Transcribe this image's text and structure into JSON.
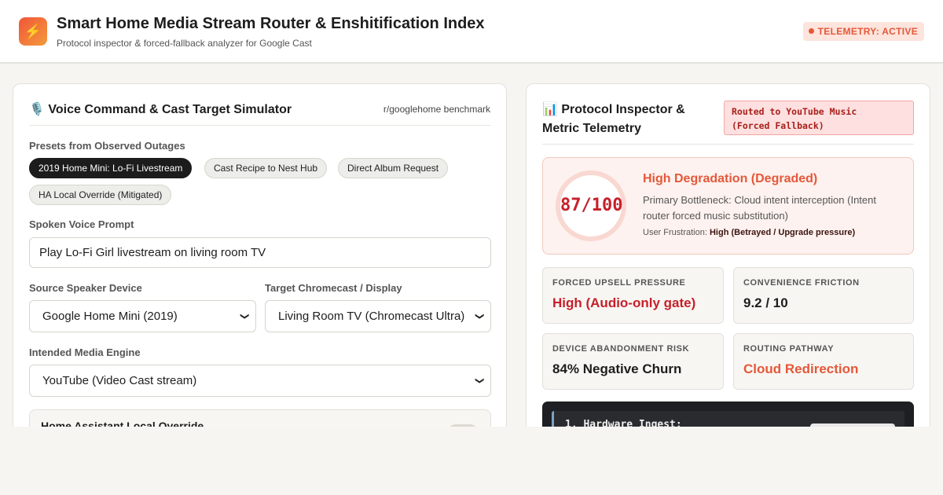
{
  "header": {
    "logo_icon": "lightning-bolt-icon",
    "logo_glyph": "⚡",
    "title": "Smart Home Media Stream Router & Enshitification Index",
    "subtitle": "Protocol inspector & forced-fallback analyzer for Google Cast",
    "status": "TELEMETRY: ACTIVE"
  },
  "simulator": {
    "icon": "microphone-icon",
    "icon_glyph": "🎙️",
    "title": "Voice Command & Cast Target Simulator",
    "meta": "r/googlehome benchmark",
    "presets_label": "Presets from Observed Outages",
    "presets": [
      {
        "label": "2019 Home Mini: Lo-Fi Livestream",
        "active": true
      },
      {
        "label": "Cast Recipe to Nest Hub",
        "active": false
      },
      {
        "label": "Direct Album Request",
        "active": false
      },
      {
        "label": "HA Local Override (Mitigated)",
        "active": false
      }
    ],
    "prompt_label": "Spoken Voice Prompt",
    "prompt_value": "Play Lo-Fi Girl livestream on living room TV",
    "source_label": "Source Speaker Device",
    "source_value": "Google Home Mini (2019)",
    "target_label": "Target Chromecast / Display",
    "target_value": "Living Room TV (Chromecast Ultra)",
    "engine_label": "Intended Media Engine",
    "engine_value": "YouTube (Video Cast stream)",
    "override_title": "Home Assistant Local Override",
    "override_enabled": false
  },
  "inspector": {
    "icon": "bar-chart-icon",
    "icon_glyph": "📊",
    "title_line1": "Protocol Inspector &",
    "title_line2": "Metric Telemetry",
    "route_line1": "Routed to YouTube Music",
    "route_line2": "(Forced Fallback)",
    "score": "87/100",
    "severity": "High Degradation (Degraded)",
    "bottleneck": "Primary Bottleneck: Cloud intent interception (Intent router forced music substitution)",
    "frustration_label": "User Frustration: ",
    "frustration_value": "High (Betrayed / Upgrade pressure)",
    "metrics": [
      {
        "label": "FORCED UPSELL PRESSURE",
        "value": "High (Audio-only gate)",
        "color": "#c6202a"
      },
      {
        "label": "CONVENIENCE FRICTION",
        "value": "9.2 / 10",
        "color": "#1d1d1d"
      },
      {
        "label": "DEVICE ABANDONMENT RISK",
        "value": "84% Negative Churn",
        "color": "#1d1d1d"
      },
      {
        "label": "ROUTING PATHWAY",
        "value": "Cloud Redirection",
        "color": "#e4583a"
      }
    ],
    "log_line": "1. Hardware Ingest:"
  }
}
